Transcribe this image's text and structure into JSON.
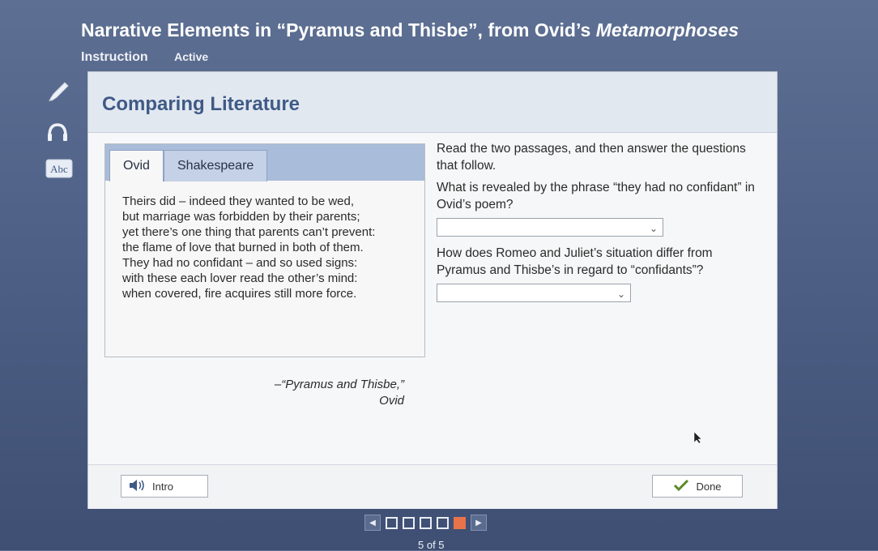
{
  "header": {
    "title_main": "Narrative Elements in “Pyramus and Thisbe”, from Ovid’s ",
    "title_italic": "Metamorphoses",
    "section": "Instruction",
    "status": "Active"
  },
  "tools": {
    "icons": [
      "pencil-icon",
      "headphones-icon",
      "dictionary-icon"
    ],
    "dictionary_label": "Abc"
  },
  "card": {
    "title": "Comparing Literature",
    "tabs": [
      {
        "label": "Ovid",
        "active": true
      },
      {
        "label": "Shakespeare",
        "active": false
      }
    ],
    "poem_lines": [
      "Theirs did – indeed they wanted to be wed,",
      "but marriage was forbidden by their parents;",
      "yet there’s one thing that parents can’t prevent:",
      "the flame of love that burned in both of them.",
      "They had no confidant – and so used signs:",
      "with these each lover read the other’s mind:",
      "when covered, fire acquires still more force."
    ],
    "citation": "–“Pyramus and Thisbe,”",
    "citation_author": "Ovid",
    "instructions": "Read the two passages, and then answer the questions that follow.",
    "question1": "What is revealed by the phrase “they had no confidant” in Ovid’s poem?",
    "question2": "How does Romeo and Juliet’s situation differ from Pyramus and Thisbe’s in regard to “confidants”?",
    "dropdown1_value": "",
    "dropdown2_value": ""
  },
  "footer": {
    "intro_label": "Intro",
    "done_label": "Done"
  },
  "pagination": {
    "current": 5,
    "total": 5,
    "label": "5 of 5"
  },
  "colors": {
    "accent": "#3f5a86",
    "current_page": "#e8734a",
    "done_check": "#5a8a2a"
  }
}
